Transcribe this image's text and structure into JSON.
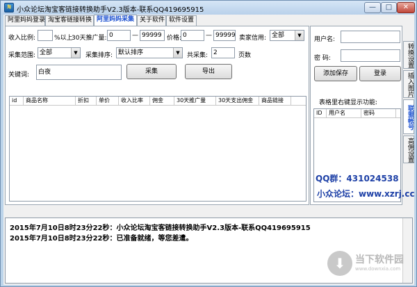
{
  "window": {
    "title": "小众论坛淘宝客链接转换助手V2.3版本-联系QQ419695915",
    "min_label": "—",
    "max_label": "□",
    "close_label": "✕"
  },
  "tabs": [
    {
      "label": "阿里妈妈登录"
    },
    {
      "label": "淘宝客链接转换"
    },
    {
      "label": "阿里妈妈采集"
    },
    {
      "label": "关于软件"
    },
    {
      "label": "软件设置"
    }
  ],
  "form": {
    "income_ratio_label": "收入比例:",
    "income_ratio_value": "",
    "percent_above_label": "%以上",
    "promo_30d_label": "30天推广量:",
    "promo_min": "0",
    "promo_dash": "—",
    "promo_max": "99999",
    "price_label": "价格:",
    "price_min": "0",
    "price_dash": "—",
    "price_max": "99999",
    "seller_credit_label": "卖家信用:",
    "seller_credit_value": "全部",
    "range_label": "采集范围:",
    "range_value": "全部",
    "sort_label": "采集排序:",
    "sort_value": "默认排序",
    "total_label": "共采集:",
    "total_value": "2",
    "pages_label": "页数",
    "keyword_label": "关键词:",
    "keyword_value": "白夜",
    "collect_button": "采集",
    "export_button": "导出"
  },
  "table": {
    "columns": [
      "id",
      "商品名称",
      "折扣",
      "单价",
      "收入比率",
      "佣金",
      "30天推广量",
      "30天支出佣金",
      "商品链接"
    ]
  },
  "side": {
    "username_label": "用户名:",
    "username_value": "",
    "password_label": "密  码:",
    "password_value": "",
    "add_button": "添加保存",
    "login_button": "登录",
    "note": "表格里右键显示功能:",
    "columns": [
      "ID",
      "用户名",
      "密码"
    ]
  },
  "vtabs": [
    {
      "label": "转换设置"
    },
    {
      "label": "插入图片"
    },
    {
      "label": "联盟帐号"
    },
    {
      "label": "高佣设置"
    }
  ],
  "contact": {
    "qq": "QQ群：431024538",
    "forum": "小众论坛：www.xzrj.cc"
  },
  "log": {
    "lines": [
      "2015年7月10日8时23分22秒：小众论坛淘宝客链接转换助手V2.3版本-联系QQ419695915",
      "2015年7月10日8时23分22秒：已准备就绪，等您差遣。"
    ]
  },
  "watermark": {
    "title": "当下软件园",
    "sub": "www.downxia.com"
  }
}
